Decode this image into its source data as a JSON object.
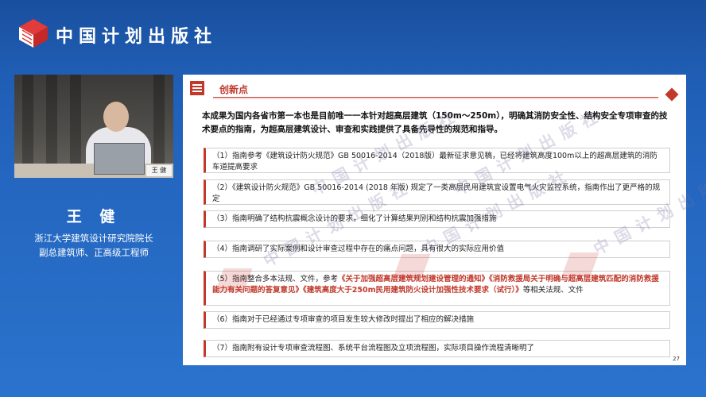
{
  "header": {
    "publisher": "中国计划出版社"
  },
  "speaker": {
    "name": "王 健",
    "nameplate": "王 健",
    "title_line1": "浙江大学建筑设计研究院院长",
    "title_line2": "副总建筑师、正高级工程师"
  },
  "slide": {
    "section_title": "创新点",
    "summary": "本成果为国内各省市第一本也是目前唯一一本针对超高层建筑（150m～250m），明确其消防安全性、结构安全专项审查的技术要点的指南，为超高层建筑设计、审查和实践提供了具备先导性的规范和指导。",
    "items": [
      {
        "text": "（1）指南参考《建筑设计防火规范》GB 50016-2014（2018版）最新征求意见稿，已经将建筑高度100m以上的超高层建筑的消防车道提高要求"
      },
      {
        "text": "（2）《建筑设计防火规范》GB 50016-2014 (2018 年版) 规定了一类高层民用建筑宜设置电气火灾监控系统，指南作出了更严格的规定"
      },
      {
        "text": "（3）指南明确了结构抗震概念设计的要求，细化了计算结果判别和结构抗震加强措施"
      },
      {
        "text": "（4）指南调研了实际案例和设计审查过程中存在的痛点问题，具有很大的实际应用价值"
      },
      {
        "prefix": "（5）指南整合多本法规、文件，参考",
        "highlight": "《关于加强超高层建筑规划建设管理的通知》《消防救援局关于明确与超高层建筑匹配的消防救援能力有关问题的答复意见》《建筑高度大于250m民用建筑防火设计加强性技术要求（试行）》",
        "suffix": "等相关法规、文件"
      },
      {
        "text": "（6）指南对于已经通过专项审查的项目发生较大修改时提出了相应的解决措施"
      },
      {
        "text": "（7）指南附有设计专项审查流程图、系统平台流程图及立项流程图，实际项目操作流程清晰明了"
      }
    ],
    "page_number": "27"
  },
  "colors": {
    "brand_blue": "#1f5eb5",
    "accent_red": "#c0392b"
  }
}
